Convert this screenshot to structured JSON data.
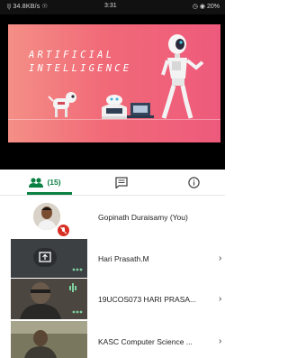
{
  "status_bar": {
    "left": "Ι͉Ι 34.8KB/s ☉",
    "time": "3:31",
    "right": "◷ ◉ 20%"
  },
  "slide": {
    "title_line1": "ARTIFICIAL",
    "title_line2": "INTELLIGENCE"
  },
  "tabs": {
    "people_count": "(15)"
  },
  "participants": [
    {
      "name": "Gopinath Duraisamy (You)"
    },
    {
      "name": "Hari Prasath.M"
    },
    {
      "name": "19UCOS073 HARI PRASA..."
    },
    {
      "name": "KASC Computer Science ..."
    }
  ],
  "colors": {
    "accent": "#0b8043",
    "muted_badge": "#d93025"
  }
}
